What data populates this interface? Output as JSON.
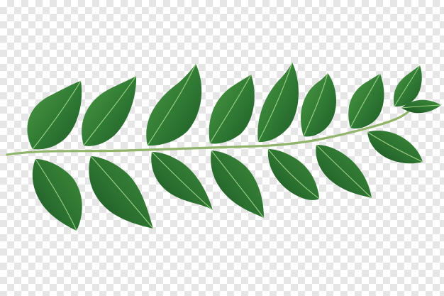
{
  "image": {
    "background": "transparency-checkerboard",
    "subject": "curry-leaf-branch",
    "colors": {
      "leaf_dark": "#1f5a26",
      "leaf_mid": "#2f7a34",
      "leaf_light": "#4e9a44",
      "stem": "#8fb46a",
      "vein": "#9fcf86",
      "checker_light": "#ffffff",
      "checker_dark": "#e6e6e6"
    },
    "leaf_count": 17
  }
}
